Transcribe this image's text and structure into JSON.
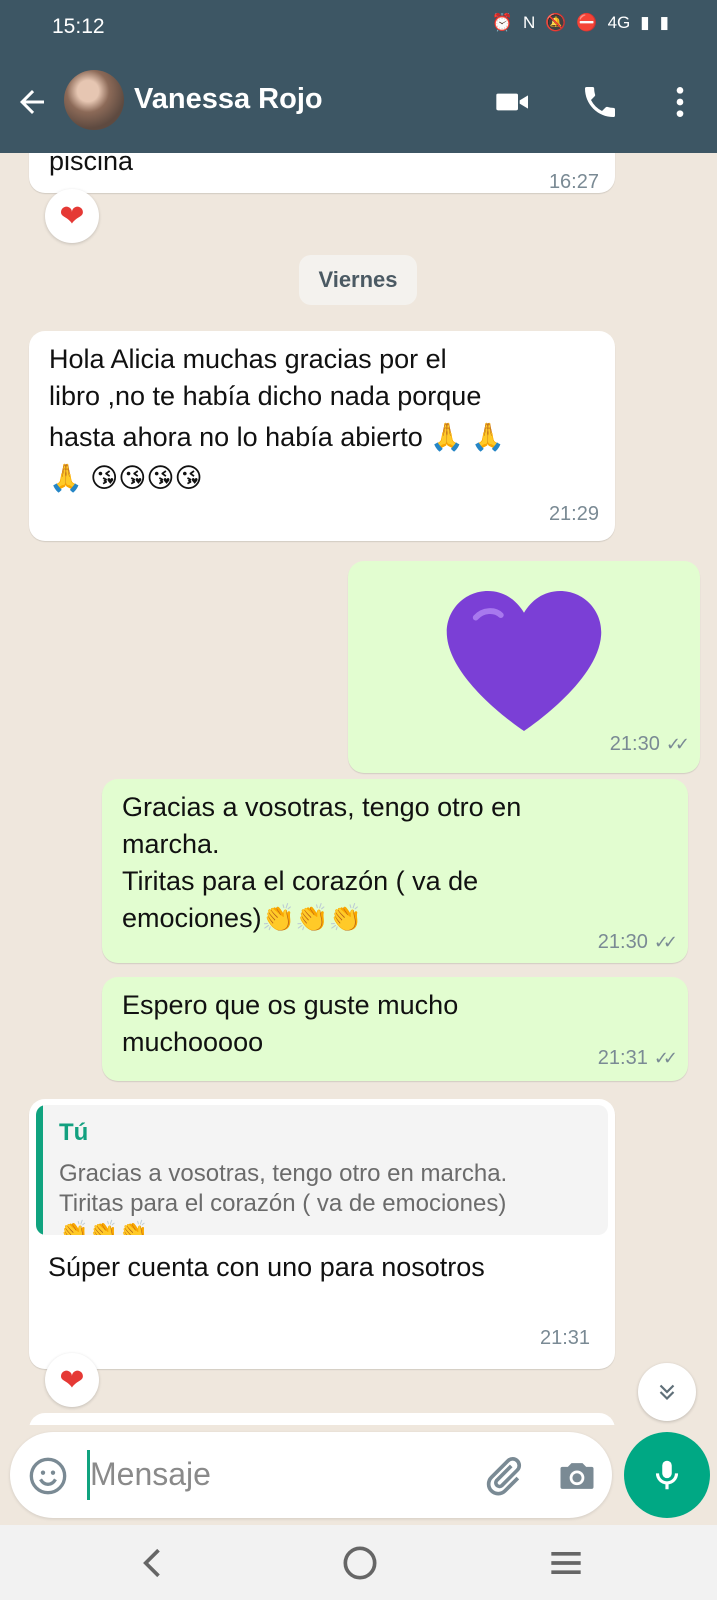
{
  "status_bar": {
    "time": "15:12",
    "network": "4G"
  },
  "header": {
    "contact_name": "Vanessa Rojo"
  },
  "messages": [
    {
      "text": "piscina",
      "time": "16:27"
    },
    {
      "day_label": "Viernes"
    },
    {
      "text_lines": [
        "Hola Alicia muchas gracias por el",
        "libro ,no te había dicho nada porque",
        "hasta ahora no lo había abierto 🙏 🙏",
        "🙏 😘😘😘😘"
      ],
      "time": "21:29"
    },
    {
      "time": "21:30"
    },
    {
      "text_lines": [
        "Gracias a vosotras, tengo otro en",
        "marcha.",
        "Tiritas para el corazón ( va de",
        "emociones)👏👏👏"
      ],
      "time": "21:30"
    },
    {
      "text_lines": [
        "Espero que os guste mucho",
        "muchooooo"
      ],
      "time": "21:31"
    },
    {
      "quote_name": "Tú",
      "quote_lines": [
        "Gracias a vosotras, tengo otro en marcha.",
        "Tiritas para el corazón ( va de emociones)",
        "👏👏👏"
      ],
      "text": "Súper cuenta con uno para nosotros",
      "time": "21:31"
    }
  ],
  "composer": {
    "placeholder": "Mensaje"
  },
  "colors": {
    "header": "#3d5664",
    "chat_bg": "#efe7dd",
    "outgoing": "#e2fdd0",
    "accent": "#00a884",
    "heart_purple": "#7b3fd6"
  },
  "icons": [
    "back-arrow-icon",
    "video-call-icon",
    "phone-icon",
    "more-vert-icon",
    "smile-icon",
    "paperclip-icon",
    "camera-icon",
    "mic-icon",
    "heart-reaction-icon",
    "chevron-double-down-icon"
  ]
}
